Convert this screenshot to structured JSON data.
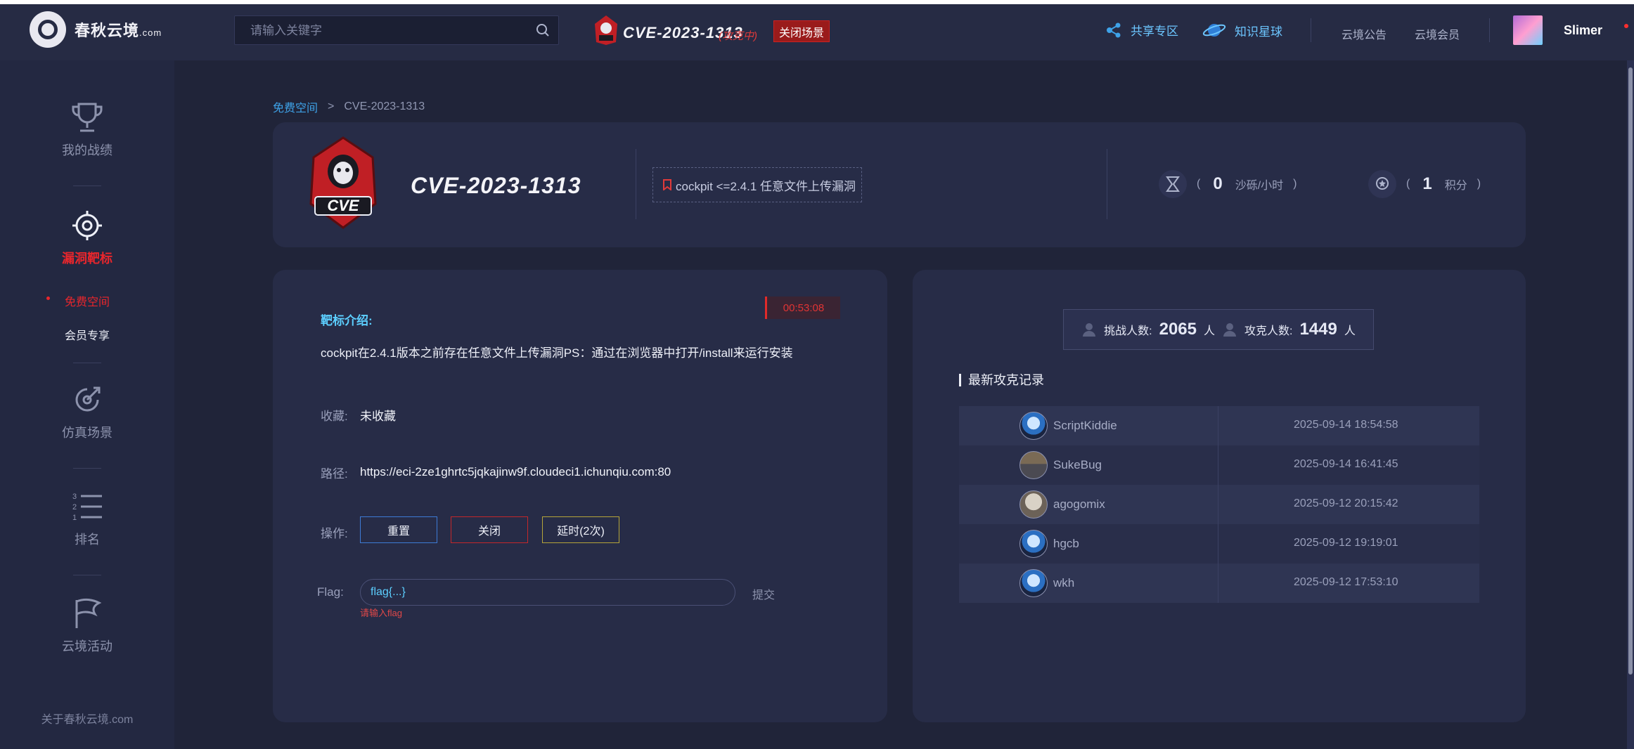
{
  "header": {
    "logo_text": "春秋云境",
    "logo_suffix": ".com",
    "search_placeholder": "请输入关键字",
    "scene_title": "CVE-2023-1313",
    "scene_status": "(攻克中)",
    "close_scene_label": "关闭场景",
    "share_label": "共享专区",
    "planet_label": "知识星球",
    "announcement_label": "云境公告",
    "member_label": "云境会员",
    "username": "Slimer"
  },
  "sidebar": {
    "record_label": "我的战绩",
    "target_label": "漏洞靶标",
    "sub_free": "免费空间",
    "sub_member": "会员专享",
    "sim_label": "仿真场景",
    "rank_label": "排名",
    "activity_label": "云境活动",
    "about_label": "关于春秋云境.com",
    "rank_digits": [
      "3",
      "2",
      "1"
    ]
  },
  "breadcrumb": {
    "root": "免费空间",
    "sep": ">",
    "current": "CVE-2023-1313"
  },
  "target": {
    "badge_text": "CVE",
    "title": "CVE-2023-1313",
    "vuln_tag": "cockpit <=2.4.1 任意文件上传漏洞",
    "sand_open": "(",
    "sand_value": "0",
    "sand_unit": "沙砾/小时",
    "sand_close": ")",
    "score_open": "(",
    "score_value": "1",
    "score_unit": "积分",
    "score_close": ")"
  },
  "details": {
    "timer": "00:53:08",
    "intro_label": "靶标介绍:",
    "intro_text": "cockpit在2.4.1版本之前存在任意文件上传漏洞PS：通过在浏览器中打开/install来运行安装",
    "fav_label": "收藏:",
    "fav_value": "未收藏",
    "path_label": "路径:",
    "path_value": "https://eci-2ze1ghrtc5jqkajinw9f.cloudeci1.ichunqiu.com:80",
    "ops_label": "操作:",
    "btn_reset": "重置",
    "btn_close": "关闭",
    "btn_extend": "延时(2次)",
    "flag_label": "Flag:",
    "flag_value": "flag{...}",
    "flag_hint": "请输入flag",
    "submit_label": "提交"
  },
  "stats": {
    "challenge_label": "挑战人数:",
    "challenge_count": "2065",
    "challenge_unit": "人",
    "solved_label": "攻克人数:",
    "solved_count": "1449",
    "solved_unit": "人",
    "records_title": "最新攻克记录",
    "records": [
      {
        "name": "ScriptKiddie",
        "time": "2025-09-14 18:54:58"
      },
      {
        "name": "SukeBug",
        "time": "2025-09-14 16:41:45"
      },
      {
        "name": "agogomix",
        "time": "2025-09-12 20:15:42"
      },
      {
        "name": "hgcb",
        "time": "2025-09-12 19:19:01"
      },
      {
        "name": "wkh",
        "time": "2025-09-12 17:53:10"
      }
    ]
  },
  "colors": {
    "background": "#202439",
    "panel": "#272c47",
    "accent_red": "#e03a3a",
    "accent_blue": "#3ea2e8",
    "accent_cyan": "#5ccfff"
  }
}
